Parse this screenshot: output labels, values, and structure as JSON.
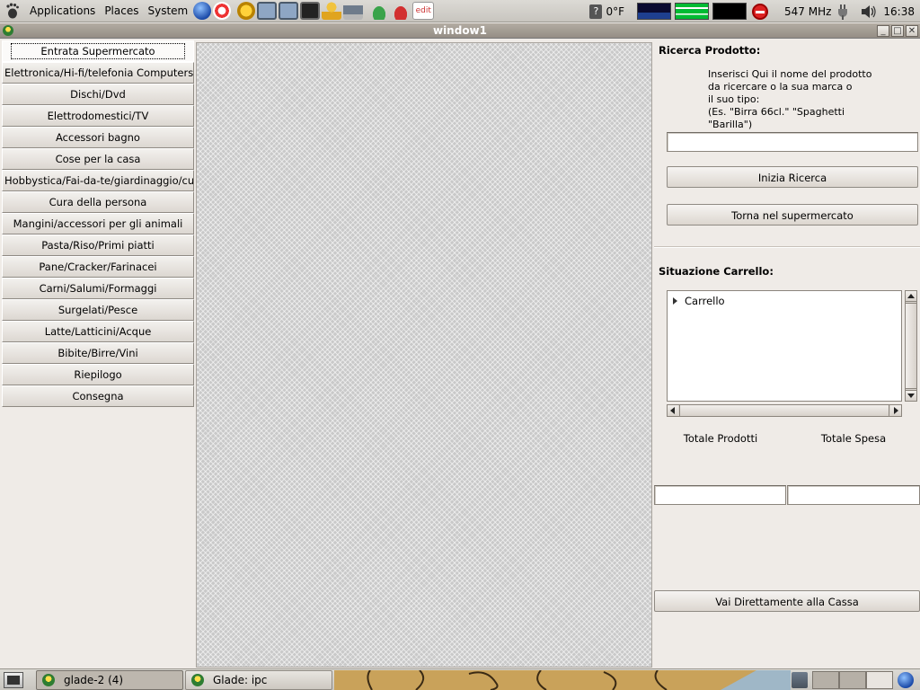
{
  "top_panel": {
    "menus": [
      "Applications",
      "Places",
      "System"
    ],
    "launchers": [
      "globe-icon",
      "help-ring-icon",
      "sun-icon",
      "monitor-icon",
      "screen-icon",
      "terminal-icon",
      "user-icon",
      "laptop-icon",
      "green-phone-icon",
      "red-phone-icon",
      "gedit-icon"
    ],
    "gedit_label": "edit",
    "weather": "0°F",
    "cpu_freq": "547 MHz",
    "clock": "16:38"
  },
  "window": {
    "title": "window1",
    "minimize": "_",
    "maximize": "□",
    "close": "✕"
  },
  "categories": [
    "Entrata Supermercato",
    "Elettronica/Hi-fi/telefonia Computers",
    "Dischi/Dvd",
    "Elettrodomestici/TV",
    "Accessori bagno",
    "Cose per la casa",
    "Hobbystica/Fai-da-te/giardinaggio/cu",
    "Cura della persona",
    "Mangini/accessori per gli animali",
    "Pasta/Riso/Primi piatti",
    "Pane/Cracker/Farinacei",
    "Carni/Salumi/Formaggi",
    "Surgelati/Pesce",
    "Latte/Latticini/Acque",
    "Bibite/Birre/Vini",
    "Riepilogo",
    "Consegna"
  ],
  "search": {
    "heading": "Ricerca Prodotto:",
    "instructions": [
      "Inserisci Qui il nome del prodotto",
      "da ricercare o la sua marca o",
      "il suo tipo:",
      "(Es. \"Birra 66cl.\" \"Spaghetti",
      "\"Barilla\")"
    ],
    "input_value": "",
    "start_button": "Inizia Ricerca",
    "back_button": "Torna nel supermercato"
  },
  "cart": {
    "heading": "Situazione Carrello:",
    "tree_root": "Carrello",
    "total_products_label": "Totale Prodotti",
    "total_spend_label": "Totale Spesa",
    "total_products_value": "",
    "total_spend_value": "",
    "checkout_button": "Vai Direttamente alla Cassa"
  },
  "taskbar": {
    "tasks": [
      "glade-2 (4)",
      "Glade: ipc"
    ]
  }
}
